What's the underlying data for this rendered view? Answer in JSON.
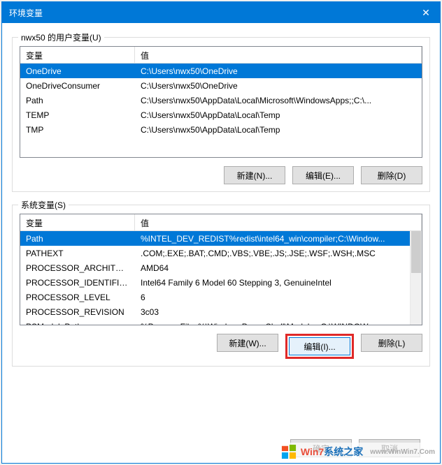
{
  "window": {
    "title": "环境变量"
  },
  "userSection": {
    "legend": "nwx50 的用户变量(U)",
    "header": {
      "name": "变量",
      "value": "值"
    },
    "rows": [
      {
        "name": "OneDrive",
        "value": "C:\\Users\\nwx50\\OneDrive",
        "sel": true
      },
      {
        "name": "OneDriveConsumer",
        "value": "C:\\Users\\nwx50\\OneDrive"
      },
      {
        "name": "Path",
        "value": "C:\\Users\\nwx50\\AppData\\Local\\Microsoft\\WindowsApps;;C:\\..."
      },
      {
        "name": "TEMP",
        "value": "C:\\Users\\nwx50\\AppData\\Local\\Temp"
      },
      {
        "name": "TMP",
        "value": "C:\\Users\\nwx50\\AppData\\Local\\Temp"
      }
    ],
    "buttons": {
      "new": "新建(N)...",
      "edit": "编辑(E)...",
      "del": "删除(D)"
    }
  },
  "sysSection": {
    "legend": "系统变量(S)",
    "header": {
      "name": "变量",
      "value": "值"
    },
    "rows": [
      {
        "name": "Path",
        "value": "%INTEL_DEV_REDIST%redist\\intel64_win\\compiler;C:\\Window...",
        "sel": true
      },
      {
        "name": "PATHEXT",
        "value": ".COM;.EXE;.BAT;.CMD;.VBS;.VBE;.JS;.JSE;.WSF;.WSH;.MSC"
      },
      {
        "name": "PROCESSOR_ARCHITECT...",
        "value": "AMD64"
      },
      {
        "name": "PROCESSOR_IDENTIFIER",
        "value": "Intel64 Family 6 Model 60 Stepping 3, GenuineIntel"
      },
      {
        "name": "PROCESSOR_LEVEL",
        "value": "6"
      },
      {
        "name": "PROCESSOR_REVISION",
        "value": "3c03"
      },
      {
        "name": "PSModulePath",
        "value": "%ProgramFiles%\\WindowsPowerShell\\Modules;C:\\WINDOW..."
      }
    ],
    "buttons": {
      "new": "新建(W)...",
      "edit": "编辑(I)...",
      "del": "删除(L)"
    }
  },
  "bottom": {
    "ok": "确定",
    "cancel": "取消"
  },
  "watermark": {
    "brand1": "Win7",
    "brand2": "系统之家",
    "url": "www.WinWin7.Com"
  }
}
